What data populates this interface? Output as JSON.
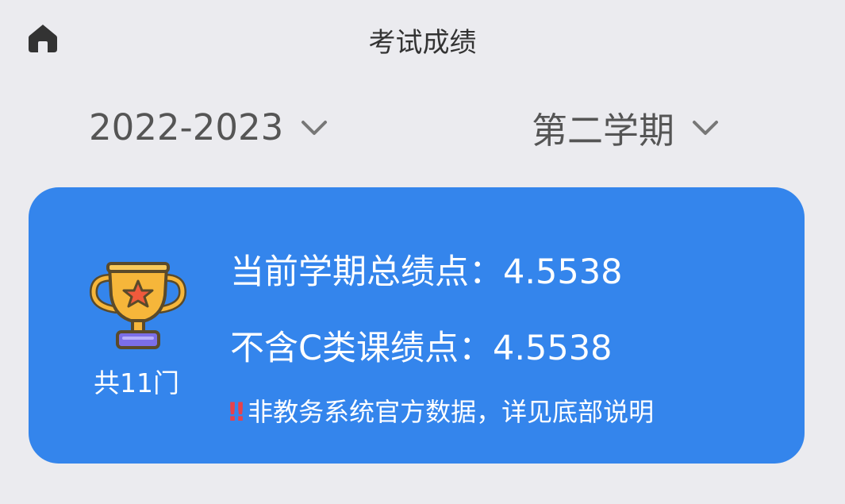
{
  "header": {
    "title": "考试成绩",
    "home_icon": "home-icon"
  },
  "filters": {
    "year": {
      "value": "2022-2023",
      "icon": "chevron-down-icon"
    },
    "semester": {
      "value": "第二学期",
      "icon": "chevron-down-icon"
    }
  },
  "summary": {
    "trophy_icon": "trophy-icon",
    "course_count": "共11门",
    "total_gpa_label": "当前学期总绩点：",
    "total_gpa_value": "4.5538",
    "no_c_gpa_label": "不含C类课绩点：",
    "no_c_gpa_value": "4.5538",
    "notice_mark": "‼",
    "notice_text": "非教务系统官方数据，详见底部说明"
  },
  "colors": {
    "background": "#ebebef",
    "card": "#3485ec",
    "warning": "#e8414a",
    "trophy_gold": "#f6b63a",
    "trophy_base": "#7b6ee8"
  }
}
